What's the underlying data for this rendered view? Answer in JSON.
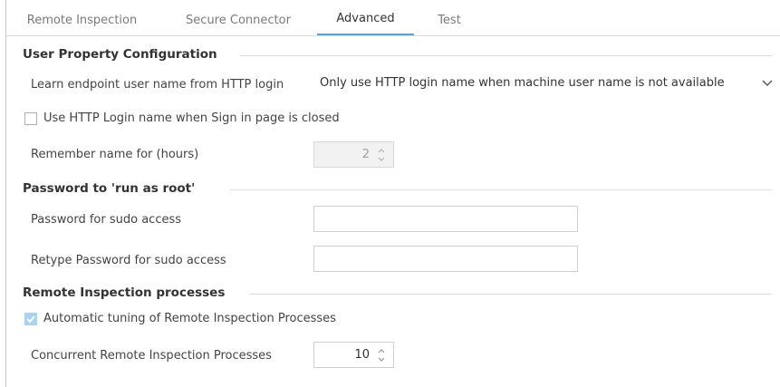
{
  "tabs": [
    {
      "label": "Remote Inspection",
      "active": false
    },
    {
      "label": "Secure Connector",
      "active": false
    },
    {
      "label": "Advanced",
      "active": true
    },
    {
      "label": "Test",
      "active": false
    }
  ],
  "sections": {
    "user_property": {
      "title": "User Property Configuration",
      "learn_label": "Learn endpoint user name from HTTP login",
      "learn_value": "Only use HTTP login name when machine user name is not available",
      "use_http_label": "Use HTTP Login name when Sign in page is closed",
      "use_http_checked": false,
      "remember_label": "Remember name for (hours)",
      "remember_value": "2"
    },
    "password": {
      "title": "Password to 'run as root'",
      "sudo_label": "Password for sudo access",
      "sudo_value": "",
      "retype_label": "Retype Password for sudo access",
      "retype_value": ""
    },
    "remote_inspection": {
      "title": "Remote Inspection processes",
      "auto_label": "Automatic tuning of Remote Inspection Processes",
      "auto_checked": true,
      "concurrent_label": "Concurrent Remote Inspection Processes",
      "concurrent_value": "10"
    }
  },
  "icons": {
    "dropdown": "chevron-down-icon",
    "spinner": "up-down-arrows-icon",
    "check": "checkmark-icon"
  },
  "colors": {
    "active_tab_underline": "#5aa3d4",
    "checked_box": "#a9d3ee"
  }
}
